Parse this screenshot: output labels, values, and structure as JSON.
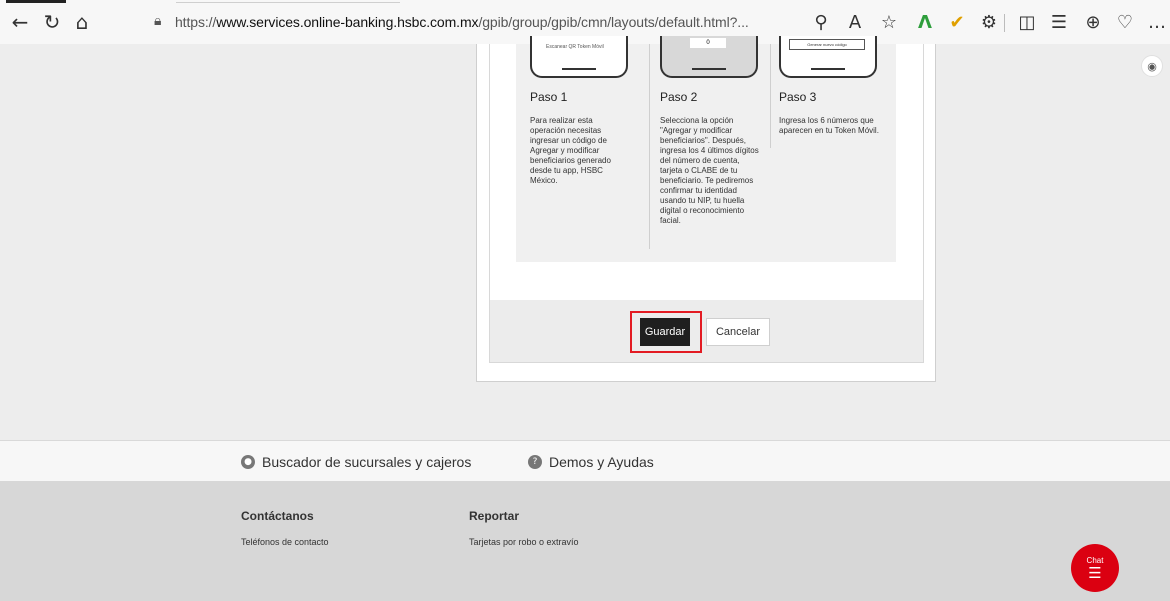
{
  "browser": {
    "url_protocol": "https://",
    "url_host": "www.services.online-banking.hsbc.com.mx",
    "url_path": "/gpib/group/gpib/cmn/layouts/default.html?..."
  },
  "steps": [
    {
      "title": "Paso 1",
      "text": "Para realizar esta operación necesitas ingresar un código de Agregar y modificar beneficiarios generado desde tu app, HSBC México."
    },
    {
      "title": "Paso 2",
      "text": "Selecciona la opción \"Agregar y modificar beneficiarios\". Después, ingresa los 4 últimos dígitos del número de cuenta, tarjeta o CLABE de tu beneficiario. Te pediremos confirmar tu identidad usando tu NIP, tu huella digital o reconocimiento facial."
    },
    {
      "title": "Paso 3",
      "text": "Ingresa los 6 números que aparecen en tu Token Móvil."
    }
  ],
  "phone_mock": {
    "p1_line1": "Escanear QR   Token Móvil",
    "p2_field": "0",
    "p3_button": "Generar nuevo código"
  },
  "actions": {
    "save_label": "Guardar",
    "cancel_label": "Cancelar"
  },
  "utility": {
    "branches_label": "Buscador de sucursales y cajeros",
    "demos_label": "Demos y Ayudas"
  },
  "footer": {
    "contact_heading": "Contáctanos",
    "contact_link": "Teléfonos de contacto",
    "report_heading": "Reportar",
    "report_link": "Tarjetas por robo o extravío",
    "chat_label": "Chat"
  }
}
